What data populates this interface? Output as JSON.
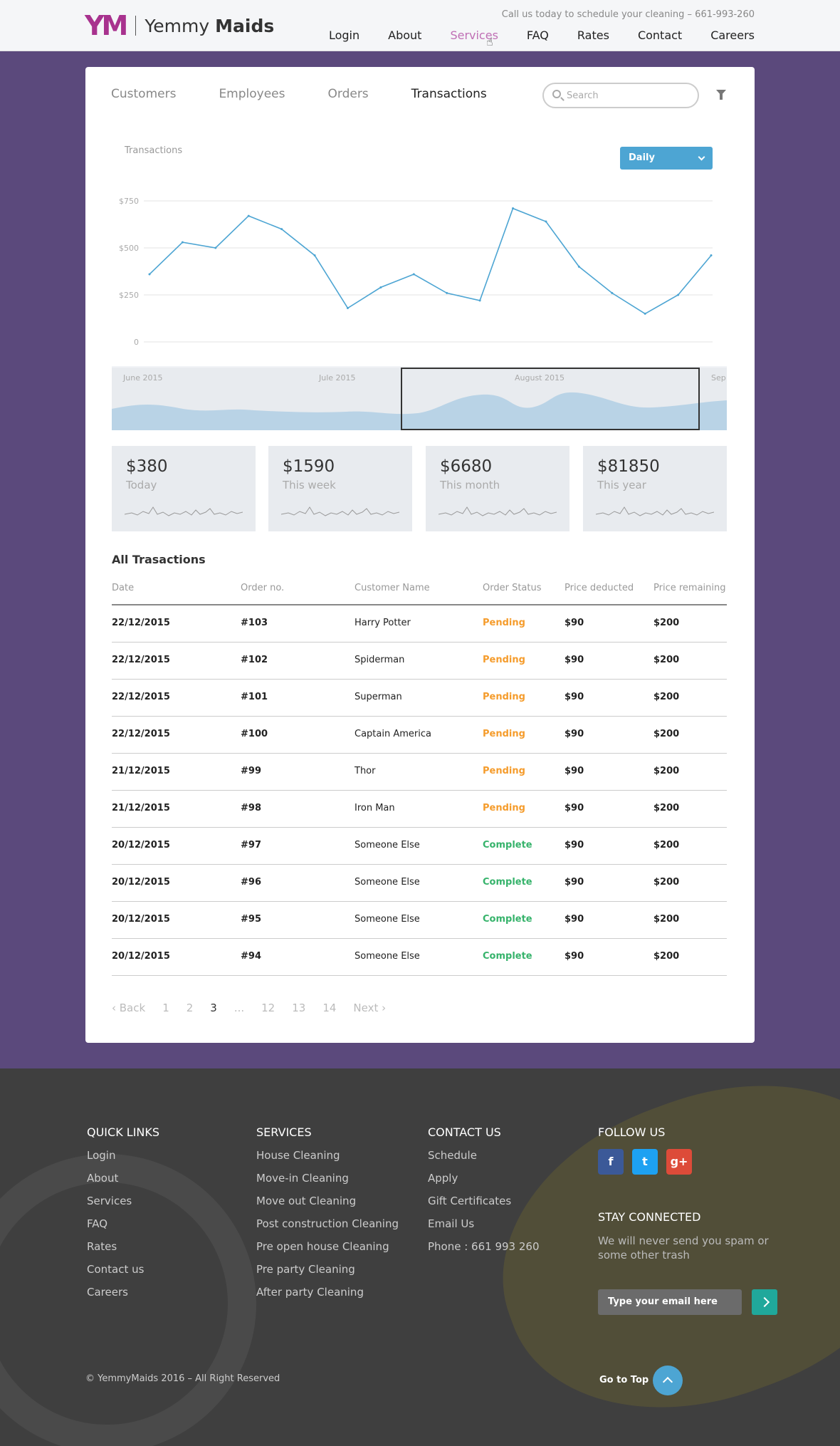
{
  "header": {
    "logo_mark": "YM",
    "brand_first": "Yemmy",
    "brand_second": "Maids",
    "callus": "Call us today to schedule your cleaning – 661-993-260",
    "nav": [
      "Login",
      "About",
      "Services",
      "FAQ",
      "Rates",
      "Contact",
      "Careers"
    ],
    "active_nav": "Services"
  },
  "tabs": [
    "Customers",
    "Employees",
    "Orders",
    "Transactions"
  ],
  "active_tab": "Transactions",
  "search": {
    "placeholder": "Search"
  },
  "chart": {
    "title": "Transactions",
    "dropdown_value": "Daily",
    "months": [
      "June 2015",
      "Jule 2015",
      "August 2015",
      "Sep"
    ]
  },
  "chart_data": {
    "type": "line",
    "title": "Transactions",
    "yticks": [
      "$750",
      "$500",
      "$250",
      "0"
    ],
    "ylim": [
      0,
      750
    ],
    "series": [
      {
        "values": [
          360,
          530,
          500,
          670,
          600,
          460,
          180,
          290,
          360,
          260,
          220,
          710,
          640,
          400,
          260,
          150,
          250,
          460
        ]
      }
    ],
    "color": "#4da5d3"
  },
  "stats": [
    {
      "value": "$380",
      "label": "Today"
    },
    {
      "value": "$1590",
      "label": "This week"
    },
    {
      "value": "$6680",
      "label": "This month"
    },
    {
      "value": "$81850",
      "label": "This year"
    }
  ],
  "table": {
    "title": "All Trasactions",
    "headers": [
      "Date",
      "Order no.",
      "Customer Name",
      "Order Status",
      "Price deducted",
      "Price remaining"
    ],
    "rows": [
      [
        "22/12/2015",
        "#103",
        "Harry Potter",
        "Pending",
        "$90",
        "$200"
      ],
      [
        "22/12/2015",
        "#102",
        "Spiderman",
        "Pending",
        "$90",
        "$200"
      ],
      [
        "22/12/2015",
        "#101",
        "Superman",
        "Pending",
        "$90",
        "$200"
      ],
      [
        "22/12/2015",
        "#100",
        "Captain America",
        "Pending",
        "$90",
        "$200"
      ],
      [
        "21/12/2015",
        "#99",
        "Thor",
        "Pending",
        "$90",
        "$200"
      ],
      [
        "21/12/2015",
        "#98",
        "Iron Man",
        "Pending",
        "$90",
        "$200"
      ],
      [
        "20/12/2015",
        "#97",
        "Someone Else",
        "Complete",
        "$90",
        "$200"
      ],
      [
        "20/12/2015",
        "#96",
        "Someone Else",
        "Complete",
        "$90",
        "$200"
      ],
      [
        "20/12/2015",
        "#95",
        "Someone Else",
        "Complete",
        "$90",
        "$200"
      ],
      [
        "20/12/2015",
        "#94",
        "Someone Else",
        "Complete",
        "$90",
        "$200"
      ]
    ]
  },
  "pager": {
    "back": "‹ Back",
    "pages": [
      "1",
      "2",
      "3",
      "...",
      "12",
      "13",
      "14"
    ],
    "current": "3",
    "next": "Next ›"
  },
  "footer": {
    "quick_links": {
      "title": "QUICK LINKS",
      "items": [
        "Login",
        "About",
        "Services",
        "FAQ",
        "Rates",
        "Contact us",
        "Careers"
      ]
    },
    "services": {
      "title": "SERVICES",
      "items": [
        "House Cleaning",
        "Move-in Cleaning",
        "Move out Cleaning",
        "Post construction Cleaning",
        "Pre open house Cleaning",
        "Pre party Cleaning",
        "After party Cleaning"
      ]
    },
    "contact": {
      "title": "CONTACT US",
      "items": [
        "Schedule",
        "Apply",
        "Gift Certificates",
        "Email Us",
        "Phone : 661 993 260"
      ]
    },
    "follow": {
      "title": "FOLLOW US",
      "social": [
        "f",
        "t",
        "g+"
      ]
    },
    "stay": {
      "title": "STAY CONNECTED",
      "text": "We will never send you spam or some other trash",
      "email_placeholder": "Type your email here"
    },
    "copyright": "© YemmyMaids 2016 – All Right Reserved",
    "gotop": "Go to Top"
  }
}
